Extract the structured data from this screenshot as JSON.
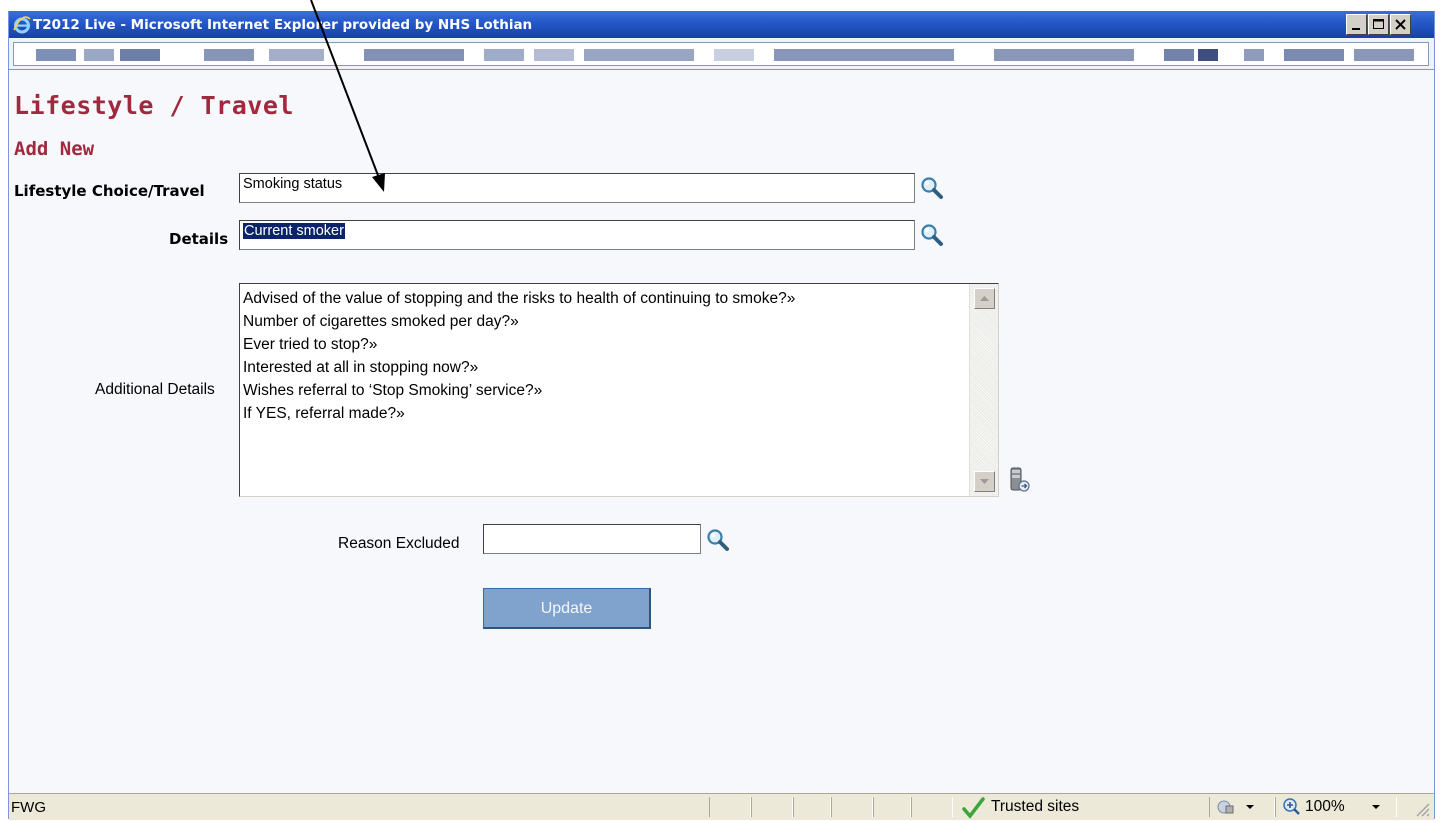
{
  "window": {
    "title": "T2012 Live - Microsoft Internet Explorer provided by NHS Lothian"
  },
  "page": {
    "heading": "Lifestyle / Travel",
    "subheading": "Add New"
  },
  "form": {
    "lifestyle_label": "Lifestyle Choice/Travel",
    "lifestyle_value": "Smoking status",
    "details_label": "Details",
    "details_value": "Current smoker",
    "additional_label": "Additional Details",
    "additional_lines": [
      "Advised of the value of stopping and the risks to health of continuing to smoke?»",
      "Number of cigarettes smoked per day?»",
      "Ever tried to stop?»",
      "Interested at all in stopping now?»",
      "Wishes referral to ‘Stop Smoking’ service?»",
      "If YES, referral made?»"
    ],
    "reason_label": "Reason Excluded",
    "reason_value": "",
    "update_label": "Update"
  },
  "statusbar": {
    "status_text": "FWG",
    "zone_text": "Trusted sites",
    "zoom_text": "100%"
  },
  "colors": {
    "heading": "#a0293e",
    "titlebar": "#2457c8",
    "update_button": "#7fa3cc"
  }
}
